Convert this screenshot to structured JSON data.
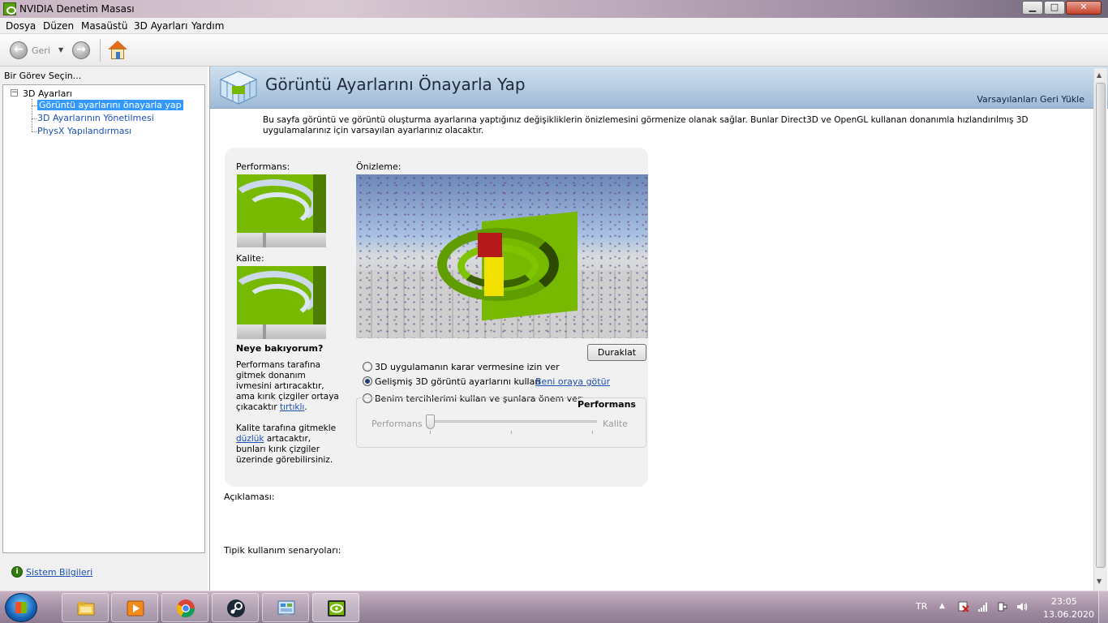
{
  "window": {
    "title": "NVIDIA Denetim Masası",
    "min_glyph": "▁",
    "max_glyph": "□",
    "close_glyph": "✕"
  },
  "menu": [
    "Dosya",
    "Düzen",
    "Masaüstü",
    "3D Ayarları",
    "Yardım"
  ],
  "toolbar": {
    "back_label": "Geri",
    "back_glyph": "←",
    "forward_glyph": "→",
    "dropdown_glyph": "▼"
  },
  "left": {
    "heading": "Bir Görev Seçin...",
    "expander_glyph": "−",
    "root": "3D Ayarları",
    "items": [
      "Görüntü ayarlarını önayarla yap",
      "3D Ayarlarının Yönetilmesi",
      "PhysX Yapılandırması"
    ],
    "system_info": "Sistem Bilgileri",
    "system_info_glyph": "i"
  },
  "main": {
    "title": "Görüntü Ayarlarını Önayarla Yap",
    "restore": "Varsayılanları Geri Yükle",
    "description": "Bu sayfa görüntü ve görüntü oluşturma ayarlarına yaptığınız değişikliklerin önizlemesini görmenize olanak sağlar. Bunlar Direct3D ve OpenGL kullanan donanımla hızlandırılmış 3D uygulamalarınız için varsayılan ayarlarınız olacaktır.",
    "performance_label": "Performans:",
    "quality_label": "Kalite:",
    "preview_label": "Önizleme:",
    "pause_button": "Duraklat",
    "options": [
      {
        "label": "3D uygulamanın karar vermesine izin ver",
        "checked": false
      },
      {
        "label": "Gelişmiş 3D görüntü ayarlarını kullan",
        "checked": true,
        "link": "Beni oraya götür"
      },
      {
        "label": "Benim tercihlerimi kullan ve şunlara önem ver:",
        "checked": false
      }
    ],
    "slider": {
      "caption": "Performans",
      "left_label": "Performans",
      "right_label": "Kalite",
      "value": 0
    },
    "explain_title": "Neye bakıyorum?",
    "explain_p1": "Performans tarafına gitmek donanım ivmesini artıracaktır, ama kırık çizgiler ortaya çıkacaktır",
    "explain_p1_link": "tırtıklı",
    "explain_p1_end": ".",
    "explain_p2_start": "Kalite tarafına  gitmekle",
    "explain_p2_link": "düzlük",
    "explain_p2_end": " artacaktır, bunları kırık çizgiler üzerinde görebilirsiniz.",
    "description_label": "Açıklaması:",
    "scenarios_label": "Tipik kullanım senaryoları:"
  },
  "scrollbar": {
    "up_glyph": "▲",
    "down_glyph": "▼"
  },
  "taskbar": {
    "lang": "TR",
    "tray_up_glyph": "▲",
    "time": "23:05",
    "date": "13.06.2020",
    "apps": [
      "explorer-icon",
      "media-player-icon",
      "chrome-icon",
      "steam-icon",
      "control-panel-icon",
      "nvidia-icon"
    ]
  }
}
